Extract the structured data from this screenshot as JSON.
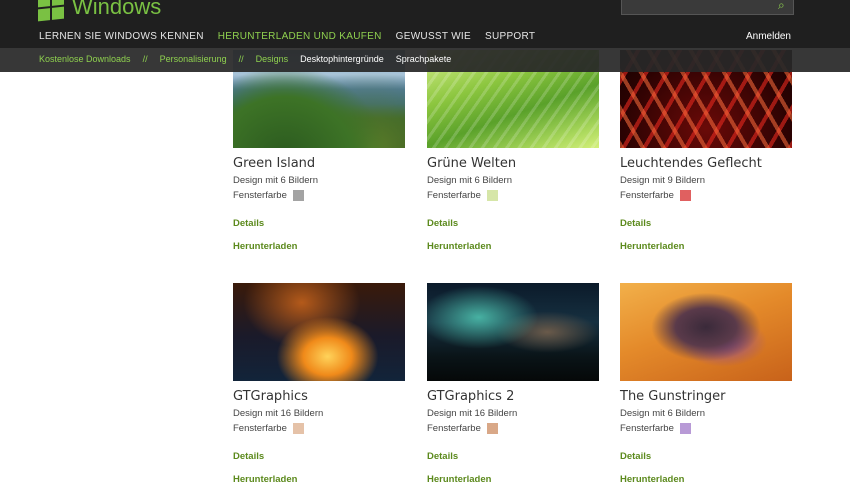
{
  "header": {
    "brand": "Windows",
    "nav": [
      {
        "label": "LERNEN SIE WINDOWS KENNEN",
        "active": false
      },
      {
        "label": "HERUNTERLADEN UND KAUFEN",
        "active": true
      },
      {
        "label": "GEWUSST WIE",
        "active": false
      },
      {
        "label": "SUPPORT",
        "active": false
      }
    ],
    "signin": "Anmelden",
    "accent": "#7ac143"
  },
  "breadcrumb": {
    "items": [
      "Kostenlose Downloads",
      "Personalisierung",
      "Designs"
    ],
    "separator": "//",
    "current": "Desktophintergründe",
    "extra": "Sprachpakete"
  },
  "tiles": [
    {
      "title": "Green Island",
      "count": "Design mit 6 Bildern",
      "color_label": "Fensterfarbe",
      "color": "#a3a3a3",
      "details": "Details",
      "download": "Herunterladen"
    },
    {
      "title": "Grüne Welten",
      "count": "Design mit 6 Bildern",
      "color_label": "Fensterfarbe",
      "color": "#d6e6a8",
      "details": "Details",
      "download": "Herunterladen"
    },
    {
      "title": "Leuchtendes Geflecht",
      "count": "Design mit 9 Bildern",
      "color_label": "Fensterfarbe",
      "color": "#e06060",
      "details": "Details",
      "download": "Herunterladen"
    },
    {
      "title": "GTGraphics",
      "count": "Design mit 16 Bildern",
      "color_label": "Fensterfarbe",
      "color": "#e5c2a8",
      "details": "Details",
      "download": "Herunterladen"
    },
    {
      "title": "GTGraphics 2",
      "count": "Design mit 16 Bildern",
      "color_label": "Fensterfarbe",
      "color": "#d9a888",
      "details": "Details",
      "download": "Herunterladen"
    },
    {
      "title": "The Gunstringer",
      "count": "Design mit 6 Bildern",
      "color_label": "Fensterfarbe",
      "color": "#b89ad6",
      "details": "Details",
      "download": "Herunterladen"
    }
  ]
}
